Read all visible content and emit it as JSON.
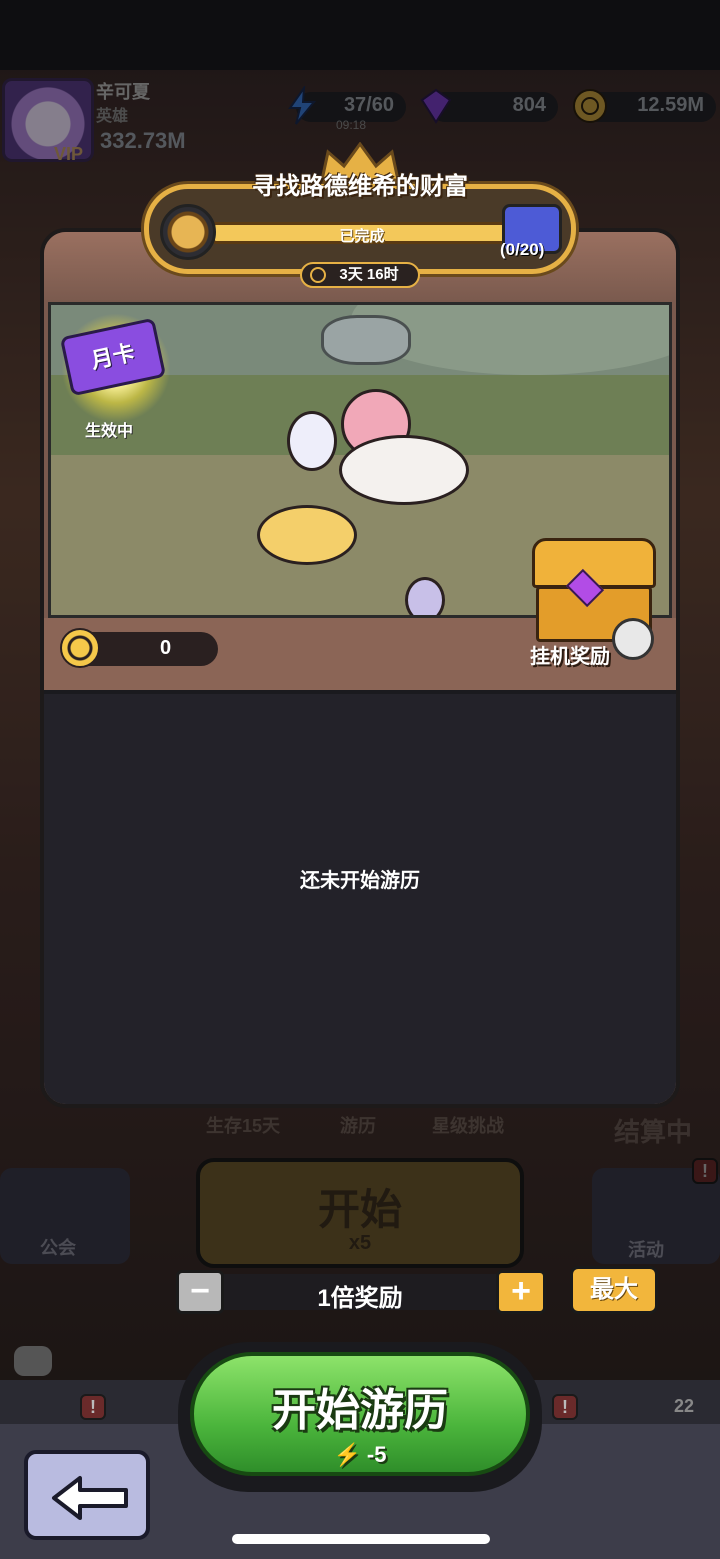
{
  "player": {
    "name": "辛可夏",
    "title": "英雄",
    "vip": "VIP",
    "power": "332.73M"
  },
  "resources": {
    "energy": {
      "value": "37/60",
      "timer": "09:18",
      "icon": "energy-bolt-icon"
    },
    "gems": {
      "value": "804",
      "icon": "purple-gem-icon"
    },
    "gold": {
      "value": "12.59M",
      "icon": "gold-coin-icon"
    }
  },
  "event": {
    "title": "寻找路德维希的财富",
    "progress_label": "已完成",
    "gift_count": "(0/20)",
    "time_left": "3天 16时"
  },
  "scene": {
    "monthly_card": {
      "label": "月卡",
      "status": "生效中"
    },
    "coins": "0",
    "idle_reward_label": "挂机奖励"
  },
  "log": {
    "empty_text": "还未开始游历"
  },
  "background": {
    "tabs": [
      "生存15天",
      "游历",
      "星级挑战"
    ],
    "settlement": "结算中",
    "start_label": "开始",
    "start_cost": "x5",
    "guild_label": "公会",
    "activity_label": "活动",
    "badge_count": "22"
  },
  "multiplier": {
    "minus": "−",
    "label": "1倍奖励",
    "plus": "+",
    "max": "最大"
  },
  "action": {
    "label": "开始游历",
    "cost": "-5"
  },
  "colors": {
    "accent_gold": "#e6b145",
    "go_green": "#4bb53c",
    "panel_dark": "#232229"
  }
}
